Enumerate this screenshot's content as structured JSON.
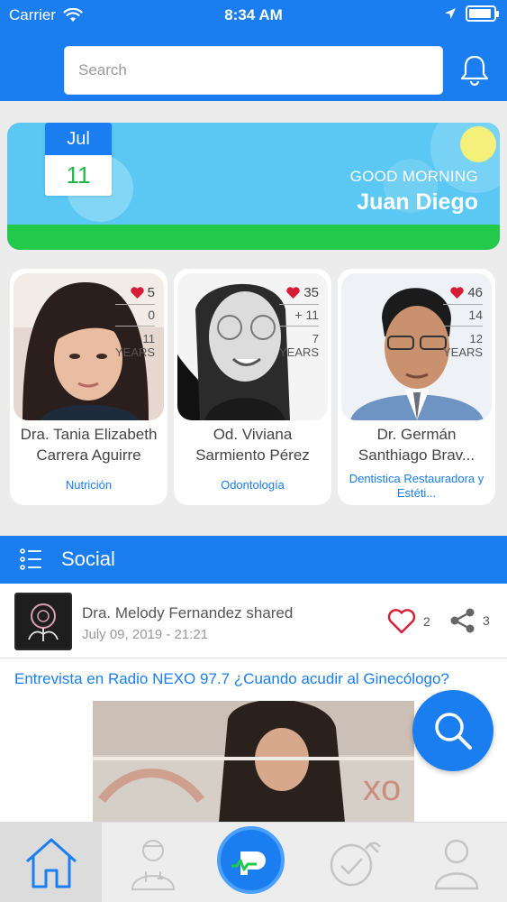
{
  "status_bar": {
    "carrier": "Carrier",
    "time": "8:34 AM",
    "icons": [
      "wifi-icon",
      "location-arrow-icon",
      "battery-icon"
    ]
  },
  "header": {
    "search_placeholder": "Search",
    "bell_icon": "bell-icon"
  },
  "greeting": {
    "month": "Jul",
    "day": "11",
    "salutation": "GOOD MORNING",
    "user_name": "Juan Diego"
  },
  "doctors": [
    {
      "name": "Dra. Tania Elizabeth Carrera Aguirre",
      "specialty": "Nutrición",
      "likes": "5",
      "plus": "0",
      "years": "11",
      "years_label": "YEARS"
    },
    {
      "name": "Od. Viviana Sarmiento Pérez",
      "specialty": "Odontología",
      "likes": "35",
      "plus": "+ 11",
      "years": "7",
      "years_label": "YEARS"
    },
    {
      "name": "Dr. Germán Santhiago Brav...",
      "specialty": "Dentistica Restauradora y Estéti...",
      "likes": "46",
      "plus": "14",
      "years": "12",
      "years_label": "YEARS"
    }
  ],
  "social": {
    "title": "Social"
  },
  "post": {
    "author": "Dra. Melody Fernandez shared",
    "date": "July 09, 2019 - 21:21",
    "likes": "2",
    "shares": "3",
    "headline": "Entrevista en Radio NEXO 97.7 ¿Cuando acudir al Ginecólogo?"
  },
  "colors": {
    "primary": "#1a7ef0",
    "green": "#22c94a",
    "sky": "#5ac8f3",
    "heart_red": "#d71c35"
  },
  "nav": {
    "tabs": [
      "home-icon",
      "doctor-icon",
      "app-logo-icon",
      "stethoscope-check-icon",
      "profile-icon"
    ],
    "active": "home-icon"
  }
}
